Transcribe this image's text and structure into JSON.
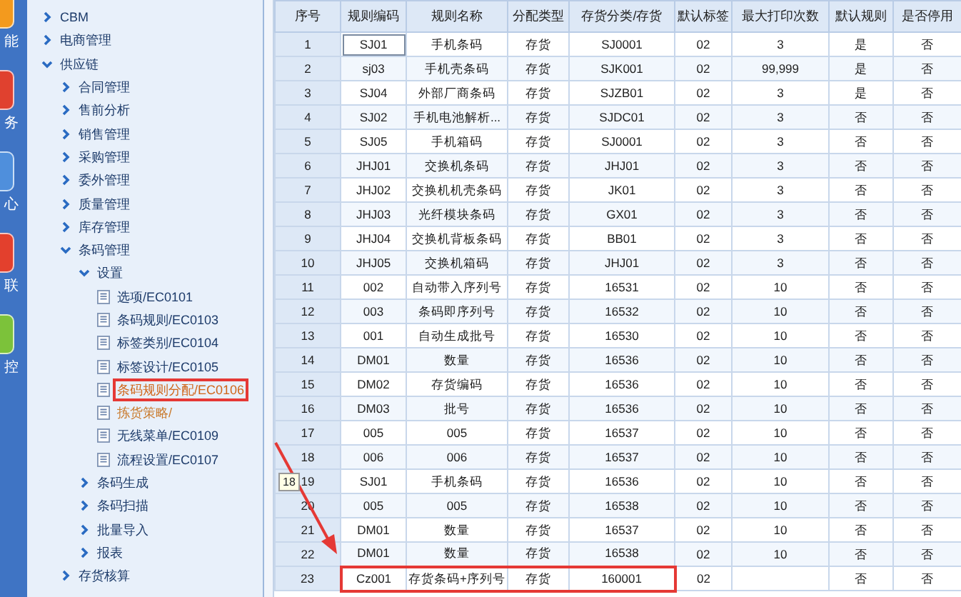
{
  "launcher": [
    {
      "label": "能"
    },
    {
      "label": "务"
    },
    {
      "label": "心"
    },
    {
      "label": "联"
    },
    {
      "label": "控"
    }
  ],
  "tree": [
    {
      "label": "CBM",
      "expanded": false,
      "selected": false
    },
    {
      "label": "电商管理",
      "expanded": false,
      "selected": false
    },
    {
      "label": "供应链",
      "expanded": true,
      "selected": false,
      "children": [
        {
          "label": "合同管理",
          "expanded": false,
          "selected": false
        },
        {
          "label": "售前分析",
          "expanded": false,
          "selected": false
        },
        {
          "label": "销售管理",
          "expanded": false,
          "selected": false
        },
        {
          "label": "采购管理",
          "expanded": false,
          "selected": false
        },
        {
          "label": "委外管理",
          "expanded": false,
          "selected": false
        },
        {
          "label": "质量管理",
          "expanded": false,
          "selected": false
        },
        {
          "label": "库存管理",
          "expanded": false,
          "selected": false
        },
        {
          "label": "条码管理",
          "expanded": true,
          "selected": false,
          "children": [
            {
              "label": "设置",
              "expanded": true,
              "selected": false,
              "children": [
                {
                  "label": "选项/EC0101",
                  "kind": "page",
                  "selected": false
                },
                {
                  "label": "条码规则/EC0103",
                  "kind": "page",
                  "selected": false
                },
                {
                  "label": "标签类别/EC0104",
                  "kind": "page",
                  "selected": false
                },
                {
                  "label": "标签设计/EC0105",
                  "kind": "page",
                  "selected": false
                },
                {
                  "label": "条码规则分配/EC0106",
                  "kind": "page",
                  "selected": true,
                  "outlined": true
                },
                {
                  "label": "拣货策略/",
                  "kind": "page",
                  "selected": false,
                  "highlighted": true
                },
                {
                  "label": "无线菜单/EC0109",
                  "kind": "page",
                  "selected": false
                },
                {
                  "label": "流程设置/EC0107",
                  "kind": "page",
                  "selected": false
                }
              ]
            },
            {
              "label": "条码生成",
              "expanded": false,
              "selected": false
            },
            {
              "label": "条码扫描",
              "expanded": false,
              "selected": false
            },
            {
              "label": "批量导入",
              "expanded": false,
              "selected": false
            },
            {
              "label": "报表",
              "expanded": false,
              "selected": false
            }
          ]
        },
        {
          "label": "存货核算",
          "expanded": false,
          "selected": false
        }
      ]
    }
  ],
  "table": {
    "columns": [
      "序号",
      "规则编码",
      "规则名称",
      "分配类型",
      "存货分类/存货",
      "默认标签",
      "最大打印次数",
      "默认规则",
      "是否停用"
    ],
    "rows": [
      {
        "cells": [
          "1",
          "SJ01",
          "手机条码",
          "存货",
          "SJ0001",
          "02",
          "3",
          "是",
          "否"
        ],
        "focused": true
      },
      {
        "cells": [
          "2",
          "sj03",
          "手机壳条码",
          "存货",
          "SJK001",
          "02",
          "99,999",
          "是",
          "否"
        ]
      },
      {
        "cells": [
          "3",
          "SJ04",
          "外部厂商条码",
          "存货",
          "SJZB01",
          "02",
          "3",
          "是",
          "否"
        ]
      },
      {
        "cells": [
          "4",
          "SJ02",
          "手机电池解析...",
          "存货",
          "SJDC01",
          "02",
          "3",
          "否",
          "否"
        ]
      },
      {
        "cells": [
          "5",
          "SJ05",
          "手机箱码",
          "存货",
          "SJ0001",
          "02",
          "3",
          "否",
          "否"
        ]
      },
      {
        "cells": [
          "6",
          "JHJ01",
          "交换机条码",
          "存货",
          "JHJ01",
          "02",
          "3",
          "否",
          "否"
        ]
      },
      {
        "cells": [
          "7",
          "JHJ02",
          "交换机机壳条码",
          "存货",
          "JK01",
          "02",
          "3",
          "否",
          "否"
        ]
      },
      {
        "cells": [
          "8",
          "JHJ03",
          "光纤模块条码",
          "存货",
          "GX01",
          "02",
          "3",
          "否",
          "否"
        ]
      },
      {
        "cells": [
          "9",
          "JHJ04",
          "交换机背板条码",
          "存货",
          "BB01",
          "02",
          "3",
          "否",
          "否"
        ]
      },
      {
        "cells": [
          "10",
          "JHJ05",
          "交换机箱码",
          "存货",
          "JHJ01",
          "02",
          "3",
          "否",
          "否"
        ]
      },
      {
        "cells": [
          "11",
          "002",
          "自动带入序列号",
          "存货",
          "16531",
          "02",
          "10",
          "否",
          "否"
        ]
      },
      {
        "cells": [
          "12",
          "003",
          "条码即序列号",
          "存货",
          "16532",
          "02",
          "10",
          "否",
          "否"
        ]
      },
      {
        "cells": [
          "13",
          "001",
          "自动生成批号",
          "存货",
          "16530",
          "02",
          "10",
          "否",
          "否"
        ]
      },
      {
        "cells": [
          "14",
          "DM01",
          "数量",
          "存货",
          "16536",
          "02",
          "10",
          "否",
          "否"
        ]
      },
      {
        "cells": [
          "15",
          "DM02",
          "存货编码",
          "存货",
          "16536",
          "02",
          "10",
          "否",
          "否"
        ]
      },
      {
        "cells": [
          "16",
          "DM03",
          "批号",
          "存货",
          "16536",
          "02",
          "10",
          "否",
          "否"
        ]
      },
      {
        "cells": [
          "17",
          "005",
          "005",
          "存货",
          "16537",
          "02",
          "10",
          "否",
          "否"
        ]
      },
      {
        "cells": [
          "18",
          "006",
          "006",
          "存货",
          "16537",
          "02",
          "10",
          "否",
          "否"
        ]
      },
      {
        "cells": [
          "19",
          "SJ01",
          "手机条码",
          "存货",
          "16536",
          "02",
          "10",
          "否",
          "否"
        ]
      },
      {
        "cells": [
          "20",
          "005",
          "005",
          "存货",
          "16538",
          "02",
          "10",
          "否",
          "否"
        ]
      },
      {
        "cells": [
          "21",
          "DM01",
          "数量",
          "存货",
          "16537",
          "02",
          "10",
          "否",
          "否"
        ]
      },
      {
        "cells": [
          "22",
          "DM01",
          "数量",
          "存货",
          "16538",
          "02",
          "10",
          "否",
          "否"
        ]
      },
      {
        "cells": [
          "23",
          "Cz001",
          "存货条码+序列号",
          "存货",
          "160001",
          "02",
          "",
          "否",
          "否"
        ],
        "outlined": true
      }
    ]
  },
  "tooltip": {
    "text": "18"
  }
}
